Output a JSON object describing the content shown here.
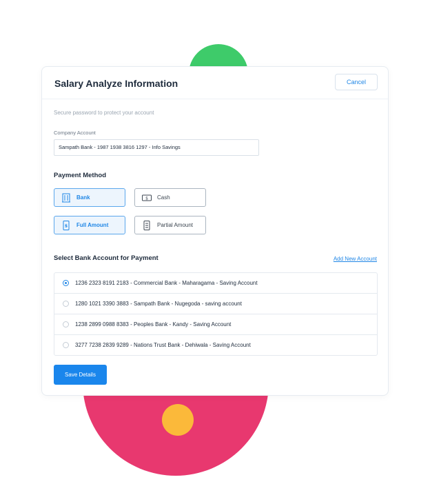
{
  "dialog": {
    "title": "Salary Analyze Information",
    "cancel_label": "Cancel",
    "subtitle": "Secure password to protect your account"
  },
  "company": {
    "label": "Company Account",
    "value": "Sampath Bank - 1987 1938 3816 1297 - Info Savings"
  },
  "payment": {
    "section_title": "Payment Method",
    "methods": [
      {
        "label": "Bank",
        "icon": "bank-icon",
        "selected": true
      },
      {
        "label": "Cash",
        "icon": "cash-icon",
        "selected": false
      }
    ],
    "amounts": [
      {
        "label": "Full Amount",
        "icon": "full-amount-icon",
        "selected": true
      },
      {
        "label": "Partial Amount",
        "icon": "partial-amount-icon",
        "selected": false
      }
    ]
  },
  "bank_accounts": {
    "section_title": "Select Bank Account for Payment",
    "add_link": "Add New Account",
    "items": [
      {
        "label": "1236 2323 8191 2183 - Commercial Bank - Maharagama - Saving Account",
        "selected": true
      },
      {
        "label": "1280 1021 3390 3883 - Sampath Bank - Nugegoda - saving account",
        "selected": false
      },
      {
        "label": "1238 2899 0988 8383 - Peoples Bank - Kandy - Saving Account",
        "selected": false
      },
      {
        "label": "3277 7238 2839 9289 - Nations Trust Bank - Dehiwala - Saving Account",
        "selected": false
      }
    ]
  },
  "save_label": "Save Details",
  "colors": {
    "accent": "#1f86e6",
    "green_decor": "#3ecb6a",
    "pink_decor": "#e8386f",
    "yellow_decor": "#fbb93a"
  }
}
